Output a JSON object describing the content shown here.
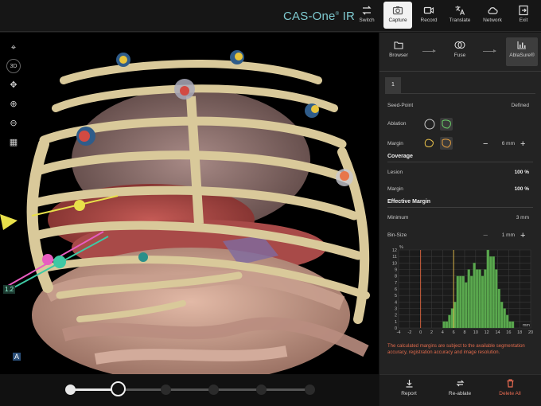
{
  "brand": {
    "name": "CAS-One",
    "mark": "®",
    "suffix": " IR"
  },
  "toolbar": [
    {
      "label": "Switch",
      "icon": "switch-icon",
      "active": false
    },
    {
      "label": "Capture",
      "icon": "camera-icon",
      "active": true
    },
    {
      "label": "Record",
      "icon": "video-camera-icon",
      "active": false
    },
    {
      "label": "Translate",
      "icon": "translate-icon",
      "active": false
    },
    {
      "label": "Network",
      "icon": "cloud-icon",
      "active": false
    },
    {
      "label": "Exit",
      "icon": "exit-icon",
      "active": false
    }
  ],
  "viewport": {
    "tools": [
      "target-icon",
      "3d-rotate-icon",
      "move-icon",
      "zoom-in-icon",
      "zoom-out-icon",
      "grid-icon"
    ],
    "rotate_label": "3D",
    "overlay_label_1": "1.2",
    "overlay_label_2": "A"
  },
  "timeline": {
    "steps": 6,
    "current": 2
  },
  "workflow": [
    {
      "label": "Browser",
      "icon": "folder-icon"
    },
    {
      "label": "Fuse",
      "icon": "fuse-icon"
    },
    {
      "label": "AblaSure®",
      "icon": "chart-icon",
      "active": true
    }
  ],
  "panel": {
    "tab": "1",
    "seed_point": {
      "label": "Seed-Point",
      "value": "Defined"
    },
    "ablation": {
      "label": "Ablation"
    },
    "margin_ctrl": {
      "label": "Margin",
      "value": "6 mm"
    },
    "coverage": {
      "title": "Coverage",
      "lesion": {
        "label": "Lesion",
        "value": "100 %"
      },
      "margin": {
        "label": "Margin",
        "value": "100 %"
      }
    },
    "effective_margin": {
      "title": "Effective Margin",
      "minimum": {
        "label": "Minimum",
        "value": "3 mm"
      },
      "bin_size": {
        "label": "Bin-Size",
        "value": "1 mm"
      }
    },
    "warning": "The calculated margins are subject to the available segmentation accuracy, registration accuracy and image resolution."
  },
  "chart_data": {
    "type": "bar",
    "ylabel": "%",
    "xlabel": "mm",
    "x_ticks": [
      -4,
      -2,
      0,
      2,
      4,
      6,
      8,
      10,
      12,
      14,
      16,
      18,
      20
    ],
    "y_ticks": [
      0,
      1,
      2,
      3,
      4,
      5,
      6,
      7,
      8,
      9,
      10,
      11,
      12
    ],
    "xlim": [
      -4,
      20
    ],
    "ylim": [
      0,
      12
    ],
    "bin_width": 0.5,
    "bins": [
      {
        "x": 4.0,
        "y": 1
      },
      {
        "x": 4.5,
        "y": 1
      },
      {
        "x": 5.0,
        "y": 2
      },
      {
        "x": 5.5,
        "y": 3
      },
      {
        "x": 6.0,
        "y": 4
      },
      {
        "x": 6.5,
        "y": 8
      },
      {
        "x": 7.0,
        "y": 8
      },
      {
        "x": 7.5,
        "y": 8
      },
      {
        "x": 8.0,
        "y": 7
      },
      {
        "x": 8.5,
        "y": 9
      },
      {
        "x": 9.0,
        "y": 8
      },
      {
        "x": 9.5,
        "y": 10
      },
      {
        "x": 10.0,
        "y": 9
      },
      {
        "x": 10.5,
        "y": 9
      },
      {
        "x": 11.0,
        "y": 8
      },
      {
        "x": 11.5,
        "y": 9
      },
      {
        "x": 12.0,
        "y": 12
      },
      {
        "x": 12.5,
        "y": 11
      },
      {
        "x": 13.0,
        "y": 11
      },
      {
        "x": 13.5,
        "y": 9
      },
      {
        "x": 14.0,
        "y": 6
      },
      {
        "x": 14.5,
        "y": 4
      },
      {
        "x": 15.0,
        "y": 3
      },
      {
        "x": 15.5,
        "y": 2
      },
      {
        "x": 16.0,
        "y": 1
      },
      {
        "x": 16.5,
        "y": 1
      }
    ],
    "reference_lines": [
      {
        "x": 0,
        "color": "#e0663f"
      },
      {
        "x": 6,
        "color": "#e8c04a"
      }
    ],
    "bar_color": "#5aa84e",
    "grid": true
  },
  "actions": [
    {
      "label": "Report",
      "icon": "download-icon"
    },
    {
      "label": "Re-ablate",
      "icon": "repeat-icon"
    },
    {
      "label": "Delete All",
      "icon": "trash-icon",
      "danger": true
    }
  ],
  "colors": {
    "accent": "#7ec9cf",
    "danger": "#ea6b52",
    "bone": "#d9c99a",
    "bar": "#5aa84e"
  }
}
